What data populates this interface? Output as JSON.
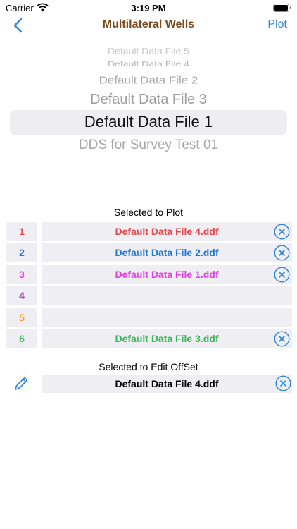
{
  "status_bar": {
    "carrier": "Carrier",
    "time": "3:19 PM"
  },
  "nav": {
    "title": "Multilateral Wells",
    "plot_label": "Plot",
    "back_icon": "chevron-left-icon"
  },
  "picker": {
    "items": [
      "Default Data File 5",
      "Default Data File 4",
      "Default Data File 2",
      "Default Data File 3",
      "Default Data File 1",
      "DDS for Survey Test 01"
    ],
    "selected": "Default Data File 1"
  },
  "plot_section": {
    "title": "Selected to Plot",
    "slots": [
      {
        "number": "1",
        "file": "Default Data File 4.ddf",
        "color": "#e5484d"
      },
      {
        "number": "2",
        "file": "Default Data File 2.ddf",
        "color": "#1f7ad6"
      },
      {
        "number": "3",
        "file": "Default Data File 1.ddf",
        "color": "#e040e0"
      },
      {
        "number": "4",
        "file": "",
        "color": "#9b4dca"
      },
      {
        "number": "5",
        "file": "",
        "color": "#f0962a"
      },
      {
        "number": "6",
        "file": "Default Data File 3.ddf",
        "color": "#3ab65a"
      }
    ]
  },
  "edit_section": {
    "title": "Selected to Edit OffSet",
    "file": "Default Data File 4.ddf"
  },
  "colors": {
    "accent": "#2e86de",
    "title": "#7a4a1c",
    "cell_bg": "#efeff3"
  }
}
